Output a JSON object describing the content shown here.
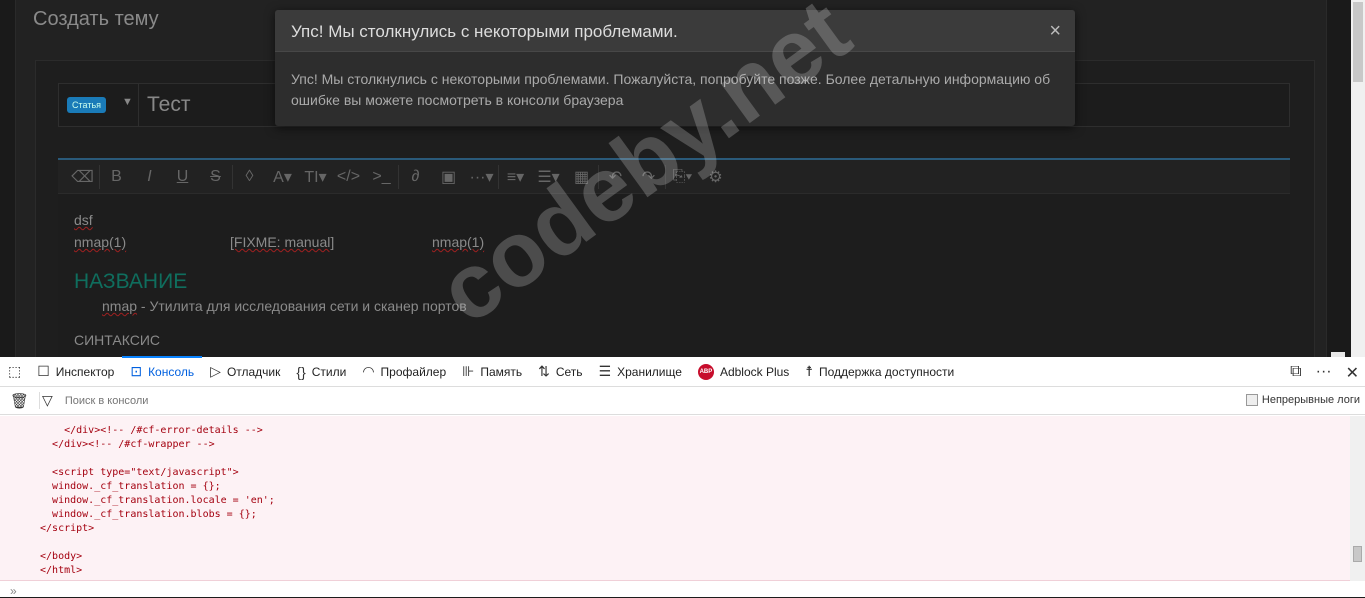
{
  "page": {
    "title": "Создать тему",
    "prefix": "Статья",
    "thread_title": "Тест"
  },
  "editor": {
    "toolbar": [
      "eraser",
      "bold",
      "italic",
      "underline",
      "strikethrough",
      "color",
      "font-size",
      "text-style",
      "code",
      "inline-code",
      "link",
      "image",
      "more",
      "align",
      "list",
      "table",
      "undo",
      "redo",
      "drafts",
      "settings"
    ],
    "lines": {
      "l1": "dsf",
      "l2a": "nmap(1)",
      "l2b": "[FIXME: manual]",
      "l2c": "nmap(1)",
      "heading": "НАЗВАНИЕ",
      "desc_a": "nmap",
      "desc_b": " - Утилита для исследования сети и сканер портов",
      "next_heading": "СИНТАКСИС"
    }
  },
  "modal": {
    "title": "Упс! Мы столкнулись с некоторыми проблемами.",
    "close": "×",
    "body": "Упс! Мы столкнулись с некоторыми проблемами. Пожалуйста, попробуйте позже. Более детальную информацию об ошибке вы можете посмотреть в консоли браузера"
  },
  "devtools": {
    "tabs": [
      {
        "label": "Инспектор",
        "icon": "☐"
      },
      {
        "label": "Консоль",
        "icon": "⊡"
      },
      {
        "label": "Отладчик",
        "icon": "▷"
      },
      {
        "label": "Стили",
        "icon": "{}"
      },
      {
        "label": "Профайлер",
        "icon": "◠"
      },
      {
        "label": "Память",
        "icon": "⊪"
      },
      {
        "label": "Сеть",
        "icon": "⇅"
      },
      {
        "label": "Хранилище",
        "icon": "☰"
      },
      {
        "label": "Adblock Plus",
        "icon": "ABP"
      },
      {
        "label": "Поддержка доступности",
        "icon": "☨"
      }
    ],
    "filter_placeholder": "Поиск в консоли",
    "persist_logs": "Непрерывные логи",
    "output": "     </div><!-- /#cf-error-details -->\n   </div><!-- /#cf-wrapper -->\n\n   <script type=\"text/javascript\">\n   window._cf_translation = {};\n   window._cf_translation.locale = 'en';\n   window._cf_translation.blobs = {};\n </script>\n\n </body>\n </html>",
    "prompt": "»"
  },
  "watermark": "codeby.net"
}
